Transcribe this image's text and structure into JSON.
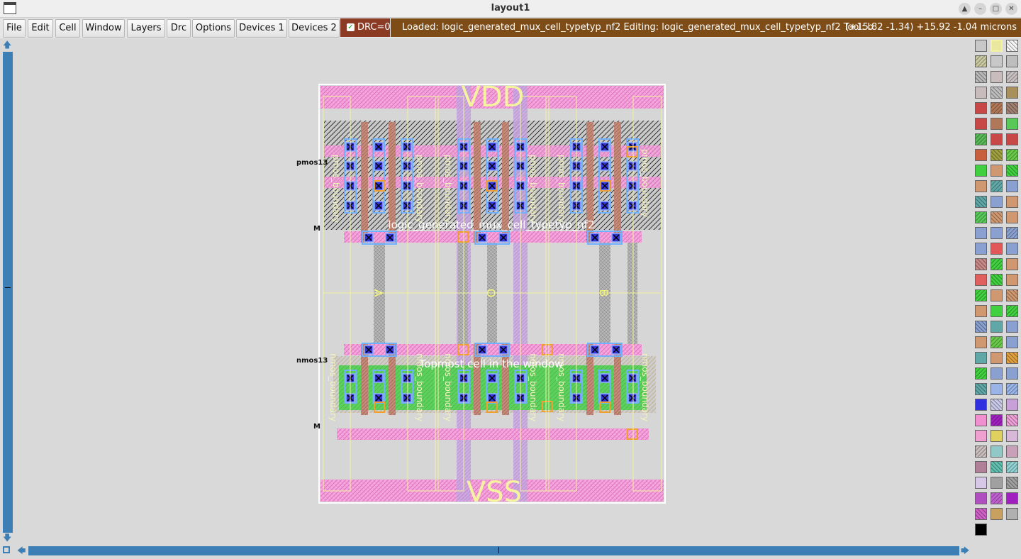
{
  "window": {
    "title": "layout1"
  },
  "menu": [
    "File",
    "Edit",
    "Cell",
    "Window",
    "Layers",
    "Drc",
    "Options",
    "Devices 1",
    "Devices 2"
  ],
  "drc": {
    "label": "DRC=0",
    "checked": true
  },
  "status": {
    "message": "Loaded: logic_generated_mux_cell_typetyp_nf2 Editing: logic_generated_mux_cell_typetyp_nf2 Tool: b",
    "coords": "(+15.82 -1.34) +15.92 -1.04 microns"
  },
  "layout": {
    "rail_top": "VDD",
    "rail_bottom": "VSS",
    "cell_name": "logic_generated_mux_cell_typetyp_nf2",
    "topmost_note": "Topmost cell in the window",
    "pmos_label": "pmos13",
    "nmos_label": "nmos13",
    "m_label": "M",
    "boundary_labels_top": [
      "pmos_boundary",
      "pmos_boundary",
      "pmos_boundary",
      "pmos_boundary",
      "pmos_boundary",
      "pmos_boundary"
    ],
    "boundary_labels_bottom": [
      "nmos_boundary",
      "nmos_boundary",
      "nmos_boundary",
      "nmos_boundary",
      "nmos_boundary",
      "nmos_boundary"
    ],
    "pins": [
      "A",
      "O",
      "B"
    ]
  },
  "colors": {
    "canvas_bg": "#d9d9d9",
    "status_bg": "#7d4c17",
    "drc_bg": "#8b3a24",
    "scroll": "#3d7fb4",
    "metal": "#f090d0",
    "poly": "#c08878",
    "diffusion": "#58d058",
    "label_yellow": "#ffff66"
  },
  "palette_colors": [
    "#c8c8c8",
    "#e8e8a0",
    "#f4f4f4",
    "#c8c8a0",
    "#c8c8c8",
    "#bdbdbd",
    "#b8b8b8",
    "#c8bcbc",
    "#c8c0c0",
    "#c8bcbc",
    "#bdbdbd",
    "#a8905c",
    "#c84848",
    "#b07858",
    "#a08070",
    "#c84848",
    "#b07858",
    "#58c858",
    "#58b858",
    "#c84848",
    "#c84848",
    "#c86040",
    "#a0a040",
    "#68c848",
    "#40d040",
    "#d09870",
    "#40d040",
    "#d09870",
    "#60a8a8",
    "#8aa0d0",
    "#60a8a8",
    "#8aa0d0",
    "#d09870",
    "#58c858",
    "#d09870",
    "#d09870",
    "#8aa0d0",
    "#8aa0d0",
    "#8aa0d0",
    "#8aa0d0",
    "#e05858",
    "#8aa0d0",
    "#c88888",
    "#40d040",
    "#d09870",
    "#e06060",
    "#40d040",
    "#d09870",
    "#40d040",
    "#d09870",
    "#d09870",
    "#d09870",
    "#40d040",
    "#40d040",
    "#8aa0d0",
    "#60a8a8",
    "#8aa0d0",
    "#d09870",
    "#68c848",
    "#8aa0d0",
    "#60a8a8",
    "#d09870",
    "#e0a040",
    "#40d040",
    "#8aa0d0",
    "#8aa0d0",
    "#60a8a8",
    "#9ab4e8",
    "#9ab4e8",
    "#3030e0",
    "#c8c8e8",
    "#c8a0d8",
    "#f090d0",
    "#a020c0",
    "#f0a0d8",
    "#f0a0d0",
    "#e0d060",
    "#d8b8d8",
    "#c8bcbc",
    "#90c8c8",
    "#c8a0b8",
    "#b08098",
    "#60c0b0",
    "#90d0d0",
    "#d8c8e8",
    "#a0a0a0",
    "#a0a0a0",
    "#b050c0",
    "#c060d0",
    "#a020c0",
    "#d060c8",
    "#c8a060",
    "#b0b0b0",
    "#000000"
  ]
}
